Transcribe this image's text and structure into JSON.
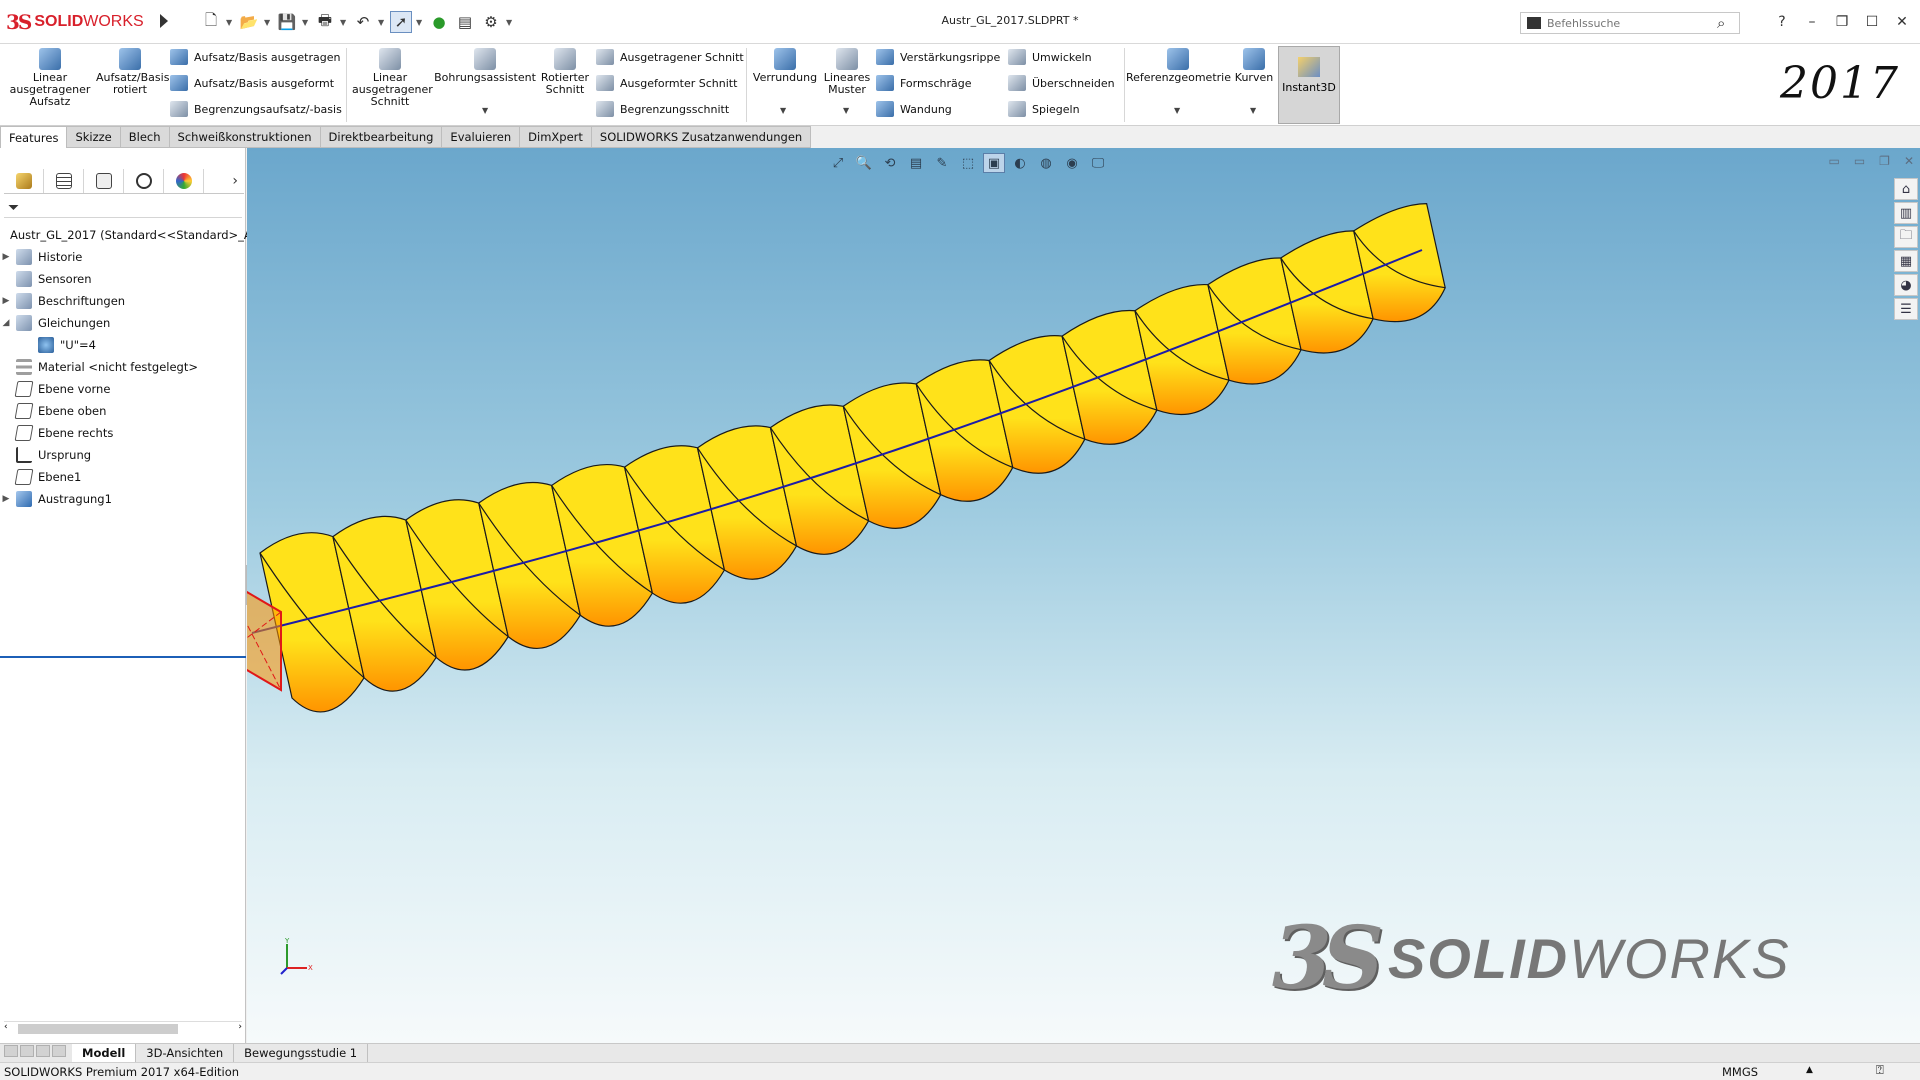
{
  "app": {
    "logo_ds": "3S",
    "logo_name_bold": "SOLID",
    "logo_name_rest": "WORKS",
    "document_title": "Austr_GL_2017.SLDPRT *",
    "year_label": "2017"
  },
  "search": {
    "placeholder": "Befehlssuche"
  },
  "window_controls": {
    "help": "?",
    "minimize": "–",
    "restore": "❐",
    "maximize": "☐",
    "close": "✕"
  },
  "ribbon": {
    "extruded_boss": "Linear ausgetragener Aufsatz",
    "revolved_boss": "Aufsatz/Basis rotiert",
    "swept_boss": "Aufsatz/Basis ausgetragen",
    "lofted_boss": "Aufsatz/Basis ausgeformt",
    "boundary_boss": "Begrenzungsaufsatz/-basis",
    "extruded_cut": "Linear ausgetragener Schnitt",
    "hole_wizard": "Bohrungsassistent",
    "revolved_cut": "Rotierter Schnitt",
    "swept_cut": "Ausgetragener Schnitt",
    "lofted_cut": "Ausgeformter Schnitt",
    "boundary_cut": "Begrenzungsschnitt",
    "fillet": "Verrundung",
    "linear_pattern": "Lineares Muster",
    "rib": "Verstärkungsrippe",
    "draft": "Formschräge",
    "shell": "Wandung",
    "wrap": "Umwickeln",
    "intersect": "Überschneiden",
    "mirror": "Spiegeln",
    "ref_geometry": "Referenzgeometrie",
    "curves": "Kurven",
    "instant3d": "Instant3D"
  },
  "tabs": [
    "Features",
    "Skizze",
    "Blech",
    "Schweißkonstruktionen",
    "Direktbearbeitung",
    "Evaluieren",
    "DimXpert",
    "SOLIDWORKS Zusatzanwendungen"
  ],
  "tree": {
    "root": "Austr_GL_2017  (Standard<<Standard>_A",
    "items": [
      {
        "label": "Historie"
      },
      {
        "label": "Sensoren"
      },
      {
        "label": "Beschriftungen"
      },
      {
        "label": "Gleichungen"
      },
      {
        "label": "\"U\"=4"
      },
      {
        "label": "Material <nicht festgelegt>"
      },
      {
        "label": "Ebene vorne"
      },
      {
        "label": "Ebene oben"
      },
      {
        "label": "Ebene rechts"
      },
      {
        "label": "Ursprung"
      },
      {
        "label": "Ebene1"
      },
      {
        "label": "Austragung1"
      }
    ]
  },
  "triad": {
    "y": "Y",
    "x": "X"
  },
  "watermark": {
    "ds": "3S",
    "name_bold": "SOLID",
    "name_rest": "WORKS"
  },
  "bottom_tabs": [
    "Modell",
    "3D-Ansichten",
    "Bewegungsstudie 1"
  ],
  "status": {
    "edition": "SOLIDWORKS Premium 2017 x64-Edition",
    "units": "MMGS"
  },
  "colors": {
    "model_light": "#ffe21a",
    "model_dark": "#ff9400",
    "path_line": "#1c1ca8",
    "profile_edge": "#e01818",
    "brand_red": "#d8202b"
  }
}
